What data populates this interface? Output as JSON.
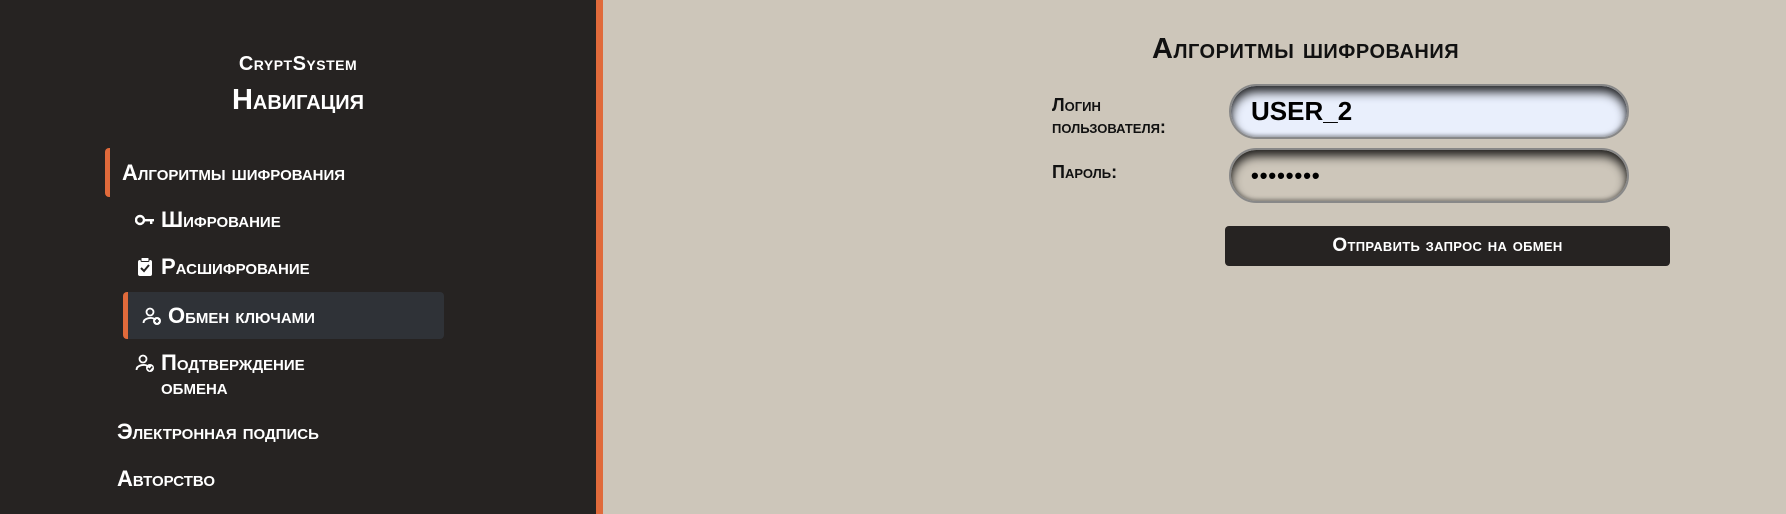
{
  "sidebar": {
    "brand": "CryptSystem",
    "title": "Навигация",
    "sections": [
      {
        "label": "Алгоритмы шифрования"
      },
      {
        "label": "Электронная подпись"
      },
      {
        "label": "Авторство"
      }
    ],
    "subitems": [
      {
        "label": "Шифрование",
        "icon": "key-icon"
      },
      {
        "label": "Расшифрование",
        "icon": "clipboard-check-icon"
      },
      {
        "label": "Обмен ключами",
        "icon": "user-add-icon"
      },
      {
        "label": "Подтверждение обмена",
        "icon": "user-check-icon"
      }
    ]
  },
  "main": {
    "title": "Алгоритмы шифрования",
    "login_label": "Логин пользователя:",
    "login_value": "USER_2",
    "password_label": "Пароль:",
    "password_value": "••••••••",
    "submit_label": "Отправить запрос на обмен"
  },
  "colors": {
    "sidebar_bg": "#262322",
    "accent": "#e06a3b",
    "page_bg": "#cdc6ba",
    "selected_bg": "#2f3237",
    "input_bg": "#e9effc"
  }
}
